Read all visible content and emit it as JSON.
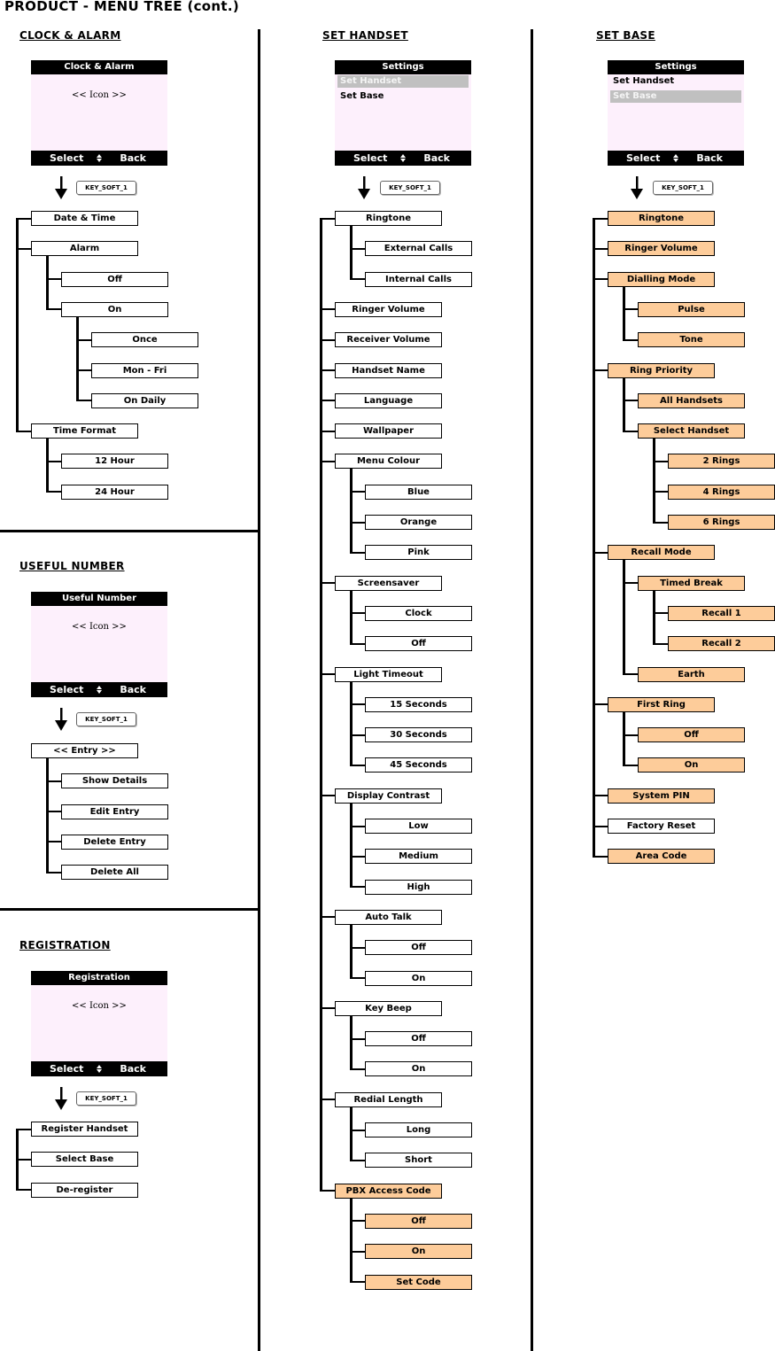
{
  "page_title": "PRODUCT - MENU TREE (cont.)",
  "colors": {
    "highlight_fill": "#fdcc9a",
    "screen_bg": "#fdf0fc",
    "selected_item": "#c0c0c0"
  },
  "key_label": "KEY_SOFT_1",
  "softkeys": {
    "select": "Select",
    "back": "Back",
    "nav_icon": "up-down-arrows-icon"
  },
  "sections": [
    {
      "id": "clock-alarm",
      "title": "CLOCK & ALARM",
      "screen": {
        "title": "Clock & Alarm",
        "icon_text": "<< Icon >>"
      },
      "tree": [
        {
          "label": "Date & Time"
        },
        {
          "label": "Alarm",
          "children": [
            {
              "label": "Off"
            },
            {
              "label": "On",
              "children": [
                {
                  "label": "Once"
                },
                {
                  "label": "Mon - Fri"
                },
                {
                  "label": "On Daily"
                }
              ]
            }
          ]
        },
        {
          "label": "Time Format",
          "children": [
            {
              "label": "12 Hour"
            },
            {
              "label": "24 Hour"
            }
          ]
        }
      ]
    },
    {
      "id": "useful-number",
      "title": "USEFUL NUMBER",
      "screen": {
        "title": "Useful Number",
        "icon_text": "<< Icon >>"
      },
      "root": {
        "label": "<< Entry >>",
        "children": [
          {
            "label": "Show Details"
          },
          {
            "label": "Edit Entry"
          },
          {
            "label": "Delete Entry"
          },
          {
            "label": "Delete All"
          }
        ]
      }
    },
    {
      "id": "registration",
      "title": "REGISTRATION",
      "screen": {
        "title": "Registration",
        "icon_text": "<< Icon >>"
      },
      "tree": [
        {
          "label": "Register Handset"
        },
        {
          "label": "Select Base"
        },
        {
          "label": "De-register"
        }
      ]
    },
    {
      "id": "set-handset",
      "title": "SET HANDSET",
      "screen": {
        "title": "Settings",
        "items": [
          {
            "label": "Set Handset",
            "selected": true
          },
          {
            "label": "Set Base",
            "selected": false
          }
        ]
      },
      "tree": [
        {
          "label": "Ringtone",
          "children": [
            {
              "label": "External Calls"
            },
            {
              "label": "Internal Calls"
            }
          ]
        },
        {
          "label": "Ringer Volume"
        },
        {
          "label": "Receiver Volume"
        },
        {
          "label": "Handset Name"
        },
        {
          "label": "Language"
        },
        {
          "label": "Wallpaper"
        },
        {
          "label": "Menu Colour",
          "children": [
            {
              "label": "Blue"
            },
            {
              "label": "Orange"
            },
            {
              "label": "Pink"
            }
          ]
        },
        {
          "label": "Screensaver",
          "children": [
            {
              "label": "Clock"
            },
            {
              "label": "Off"
            }
          ]
        },
        {
          "label": "Light Timeout",
          "children": [
            {
              "label": "15 Seconds"
            },
            {
              "label": "30 Seconds"
            },
            {
              "label": "45 Seconds"
            }
          ]
        },
        {
          "label": "Display Contrast",
          "children": [
            {
              "label": "Low"
            },
            {
              "label": "Medium"
            },
            {
              "label": "High"
            }
          ]
        },
        {
          "label": "Auto Talk",
          "children": [
            {
              "label": "Off"
            },
            {
              "label": "On"
            }
          ]
        },
        {
          "label": "Key Beep",
          "children": [
            {
              "label": "Off"
            },
            {
              "label": "On"
            }
          ]
        },
        {
          "label": "Redial Length",
          "children": [
            {
              "label": "Long"
            },
            {
              "label": "Short"
            }
          ]
        },
        {
          "label": "PBX Access Code",
          "highlight": true,
          "children": [
            {
              "label": "Off",
              "highlight": true
            },
            {
              "label": "On",
              "highlight": true
            },
            {
              "label": "Set Code",
              "highlight": true
            }
          ]
        }
      ]
    },
    {
      "id": "set-base",
      "title": "SET BASE",
      "screen": {
        "title": "Settings",
        "items": [
          {
            "label": "Set Handset",
            "selected": false
          },
          {
            "label": "Set Base",
            "selected": true
          }
        ]
      },
      "tree": [
        {
          "label": "Ringtone",
          "highlight": true
        },
        {
          "label": "Ringer Volume",
          "highlight": true
        },
        {
          "label": "Dialling Mode",
          "highlight": true,
          "children": [
            {
              "label": "Pulse",
              "highlight": true
            },
            {
              "label": "Tone",
              "highlight": true
            }
          ]
        },
        {
          "label": "Ring Priority",
          "highlight": true,
          "children": [
            {
              "label": "All Handsets",
              "highlight": true
            },
            {
              "label": "Select Handset",
              "highlight": true,
              "children": [
                {
                  "label": "2 Rings",
                  "highlight": true
                },
                {
                  "label": "4 Rings",
                  "highlight": true
                },
                {
                  "label": "6 Rings",
                  "highlight": true
                }
              ]
            }
          ]
        },
        {
          "label": "Recall Mode",
          "highlight": true,
          "children": [
            {
              "label": "Timed Break",
              "highlight": true,
              "children": [
                {
                  "label": "Recall 1",
                  "highlight": true
                },
                {
                  "label": "Recall 2",
                  "highlight": true
                }
              ]
            },
            {
              "label": "Earth",
              "highlight": true
            }
          ]
        },
        {
          "label": "First Ring",
          "highlight": true,
          "children": [
            {
              "label": "Off",
              "highlight": true
            },
            {
              "label": "On",
              "highlight": true
            }
          ]
        },
        {
          "label": "System PIN",
          "highlight": true
        },
        {
          "label": "Factory Reset",
          "highlight": false
        },
        {
          "label": "Area Code",
          "highlight": true
        }
      ]
    }
  ]
}
